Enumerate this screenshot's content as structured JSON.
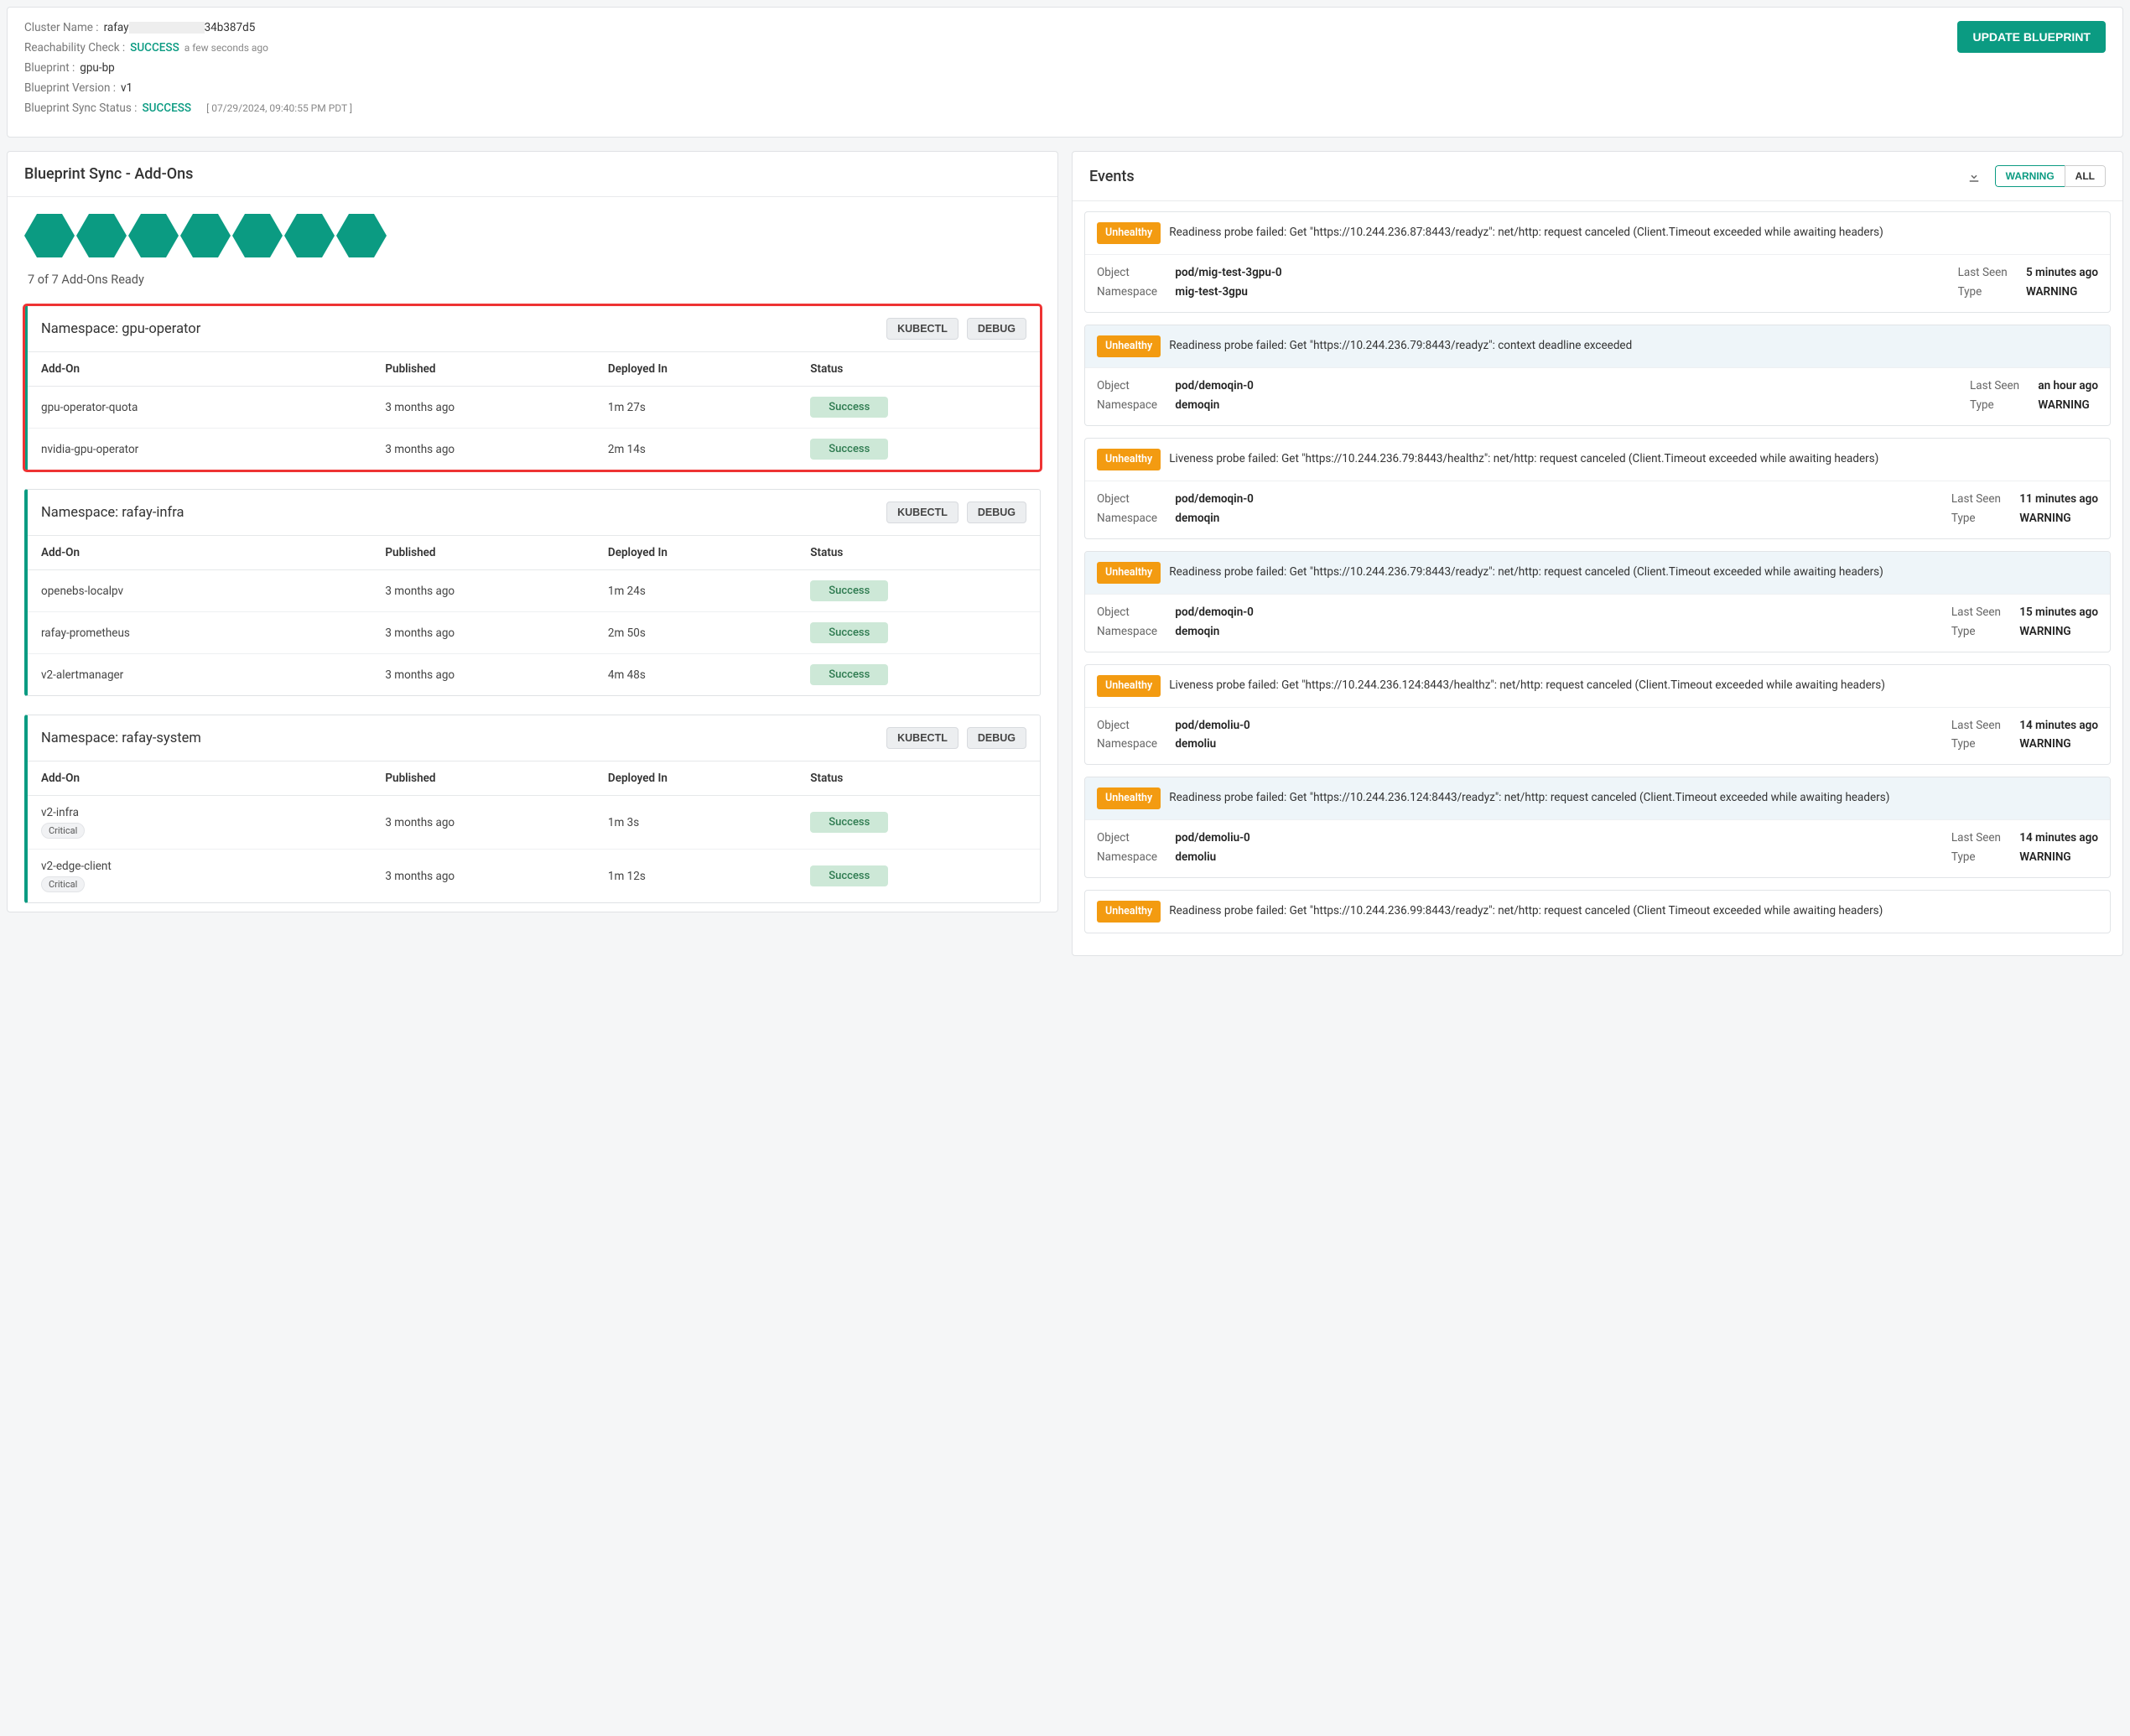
{
  "header": {
    "cluster_name_label": "Cluster Name :",
    "cluster_name_prefix": "rafay",
    "cluster_name_suffix": "34b387d5",
    "reachability_label": "Reachability Check :",
    "reachability_status": "SUCCESS",
    "reachability_time": "a few seconds ago",
    "blueprint_label": "Blueprint :",
    "blueprint_value": "gpu-bp",
    "blueprint_version_label": "Blueprint Version :",
    "blueprint_version_value": "v1",
    "sync_status_label": "Blueprint Sync Status :",
    "sync_status_value": "SUCCESS",
    "sync_status_ts": "[ 07/29/2024, 09:40:55 PM PDT ]",
    "update_button": "UPDATE BLUEPRINT"
  },
  "addons": {
    "title": "Blueprint Sync - Add-Ons",
    "ready_text": "7 of 7 Add-Ons Ready",
    "hex_count": 7,
    "columns": {
      "addon": "Add-On",
      "published": "Published",
      "deployed": "Deployed In",
      "status": "Status"
    },
    "kubectl": "KUBECTL",
    "debug": "DEBUG",
    "critical_label": "Critical",
    "namespaces": [
      {
        "title": "Namespace: gpu-operator",
        "highlight": true,
        "rows": [
          {
            "name": "gpu-operator-quota",
            "published": "3 months ago",
            "deployed": "1m 27s",
            "status": "Success"
          },
          {
            "name": "nvidia-gpu-operator",
            "published": "3 months ago",
            "deployed": "2m 14s",
            "status": "Success"
          }
        ]
      },
      {
        "title": "Namespace: rafay-infra",
        "highlight": false,
        "rows": [
          {
            "name": "openebs-localpv",
            "published": "3 months ago",
            "deployed": "1m 24s",
            "status": "Success"
          },
          {
            "name": "rafay-prometheus",
            "published": "3 months ago",
            "deployed": "2m 50s",
            "status": "Success"
          },
          {
            "name": "v2-alertmanager",
            "published": "3 months ago",
            "deployed": "4m 48s",
            "status": "Success"
          }
        ]
      },
      {
        "title": "Namespace: rafay-system",
        "highlight": false,
        "rows": [
          {
            "name": "v2-infra",
            "critical": true,
            "published": "3 months ago",
            "deployed": "1m 3s",
            "status": "Success"
          },
          {
            "name": "v2-edge-client",
            "critical": true,
            "published": "3 months ago",
            "deployed": "1m 12s",
            "status": "Success"
          }
        ]
      }
    ]
  },
  "events": {
    "title": "Events",
    "filter_warning": "WARNING",
    "filter_all": "ALL",
    "labels": {
      "object": "Object",
      "namespace": "Namespace",
      "last_seen": "Last Seen",
      "type": "Type"
    },
    "list": [
      {
        "badge": "Unhealthy",
        "tint": false,
        "msg": "Readiness probe failed: Get \"https://10.244.236.87:8443/readyz\": net/http: request canceled (Client.Timeout exceeded while awaiting headers)",
        "object": "pod/mig-test-3gpu-0",
        "namespace": "mig-test-3gpu",
        "last_seen": "5 minutes ago",
        "type": "WARNING"
      },
      {
        "badge": "Unhealthy",
        "tint": true,
        "msg": "Readiness probe failed: Get \"https://10.244.236.79:8443/readyz\": context deadline exceeded",
        "object": "pod/demoqin-0",
        "namespace": "demoqin",
        "last_seen": "an hour ago",
        "type": "WARNING"
      },
      {
        "badge": "Unhealthy",
        "tint": false,
        "msg": "Liveness probe failed: Get \"https://10.244.236.79:8443/healthz\": net/http: request canceled (Client.Timeout exceeded while awaiting headers)",
        "object": "pod/demoqin-0",
        "namespace": "demoqin",
        "last_seen": "11 minutes ago",
        "type": "WARNING"
      },
      {
        "badge": "Unhealthy",
        "tint": true,
        "msg": "Readiness probe failed: Get \"https://10.244.236.79:8443/readyz\": net/http: request canceled (Client.Timeout exceeded while awaiting headers)",
        "object": "pod/demoqin-0",
        "namespace": "demoqin",
        "last_seen": "15 minutes ago",
        "type": "WARNING"
      },
      {
        "badge": "Unhealthy",
        "tint": false,
        "msg": "Liveness probe failed: Get \"https://10.244.236.124:8443/healthz\": net/http: request canceled (Client.Timeout exceeded while awaiting headers)",
        "object": "pod/demoliu-0",
        "namespace": "demoliu",
        "last_seen": "14 minutes ago",
        "type": "WARNING"
      },
      {
        "badge": "Unhealthy",
        "tint": true,
        "msg": "Readiness probe failed: Get \"https://10.244.236.124:8443/readyz\": net/http: request canceled (Client.Timeout exceeded while awaiting headers)",
        "object": "pod/demoliu-0",
        "namespace": "demoliu",
        "last_seen": "14 minutes ago",
        "type": "WARNING"
      },
      {
        "badge": "Unhealthy",
        "tint": false,
        "partial": true,
        "msg": "Readiness probe failed: Get \"https://10.244.236.99:8443/readyz\": net/http: request canceled (Client Timeout exceeded while awaiting headers)"
      }
    ]
  }
}
